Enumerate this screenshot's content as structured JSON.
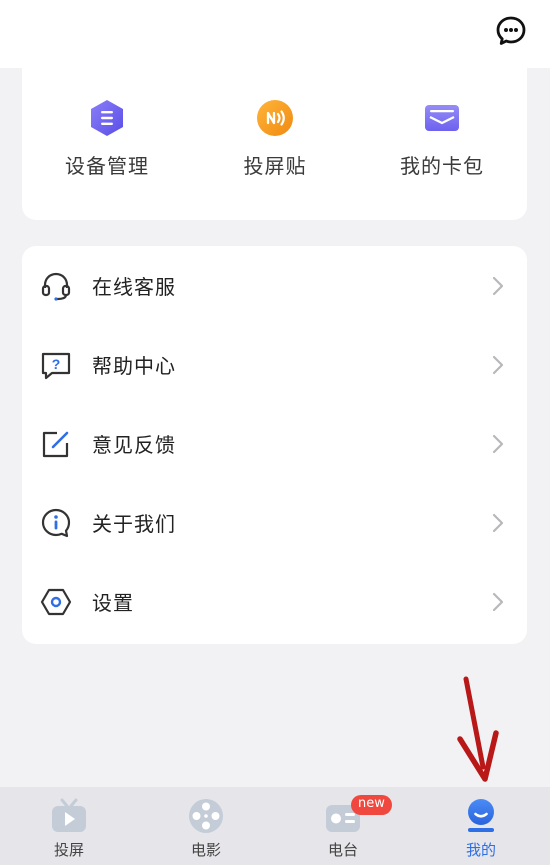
{
  "quick_actions": [
    {
      "label": "设备管理",
      "icon": "device-manage-icon",
      "color": "#6b63f0"
    },
    {
      "label": "投屏贴",
      "icon": "nfc-sticker-icon",
      "color": "#f7a21c"
    },
    {
      "label": "我的卡包",
      "icon": "card-wallet-icon",
      "color": "#7e74f2"
    }
  ],
  "menu": [
    {
      "label": "在线客服",
      "icon": "headset-icon"
    },
    {
      "label": "帮助中心",
      "icon": "help-icon"
    },
    {
      "label": "意见反馈",
      "icon": "feedback-edit-icon"
    },
    {
      "label": "关于我们",
      "icon": "info-icon"
    },
    {
      "label": "设置",
      "icon": "settings-hexagon-icon"
    }
  ],
  "tabs": [
    {
      "label": "投屏",
      "icon": "tv-play-icon",
      "active": false
    },
    {
      "label": "电影",
      "icon": "film-reel-icon",
      "active": false
    },
    {
      "label": "电台",
      "icon": "radio-icon",
      "active": false,
      "badge": "new"
    },
    {
      "label": "我的",
      "icon": "profile-icon",
      "active": true
    }
  ],
  "colors": {
    "accent": "#2f6fe6",
    "tab_inactive": "#c4ccd8",
    "badge": "#f0483e",
    "annotation_arrow": "#b81818"
  }
}
